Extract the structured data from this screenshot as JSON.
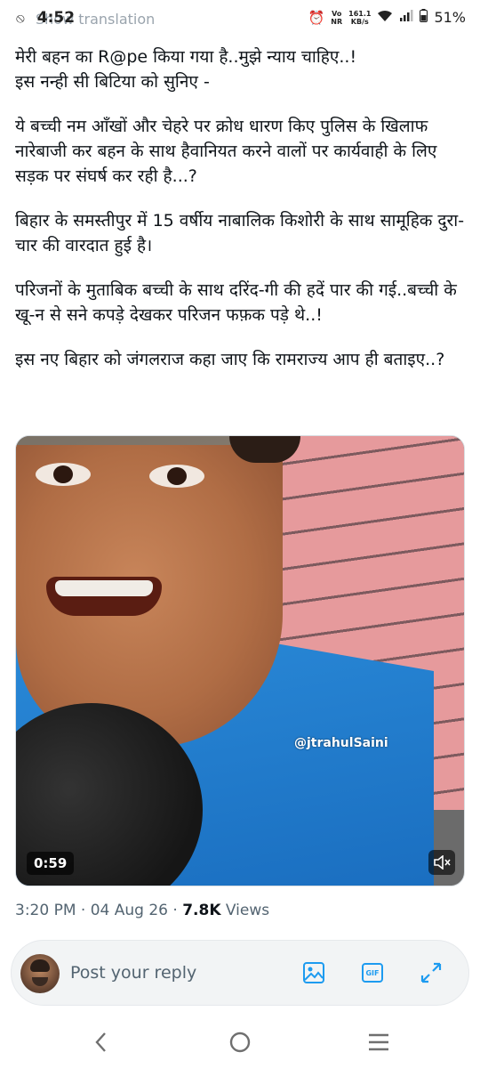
{
  "status_bar": {
    "time": "4:52",
    "ghost_text": "Show translation",
    "network_label": "Vo\nNR",
    "speed_value": "161.1",
    "speed_unit": "KB/s",
    "battery": "51%"
  },
  "tweet": {
    "paragraphs": [
      "मेरी बहन का R@pe किया गया है..मुझे न्याय चाहिए..!\nइस नन्ही सी बिटिया को सुनिए -",
      "ये बच्ची नम आँखों और चेहरे पर क्रोध धारण किए पुलिस के खिलाफ नारेबाजी कर बहन के साथ हैवानियत करने वालों पर कार्यवाही के लिए सड़क पर संघर्ष कर रही है...?",
      "बिहार के समस्तीपुर में 15 वर्षीय नाबालिक किशोरी के साथ सामूहिक दुरा-चार की वारदात हुई है।",
      "परिजनों के मुताबिक बच्ची के साथ दरिंद-गी की हदें पार की गई..बच्ची के खू-न से सने कपड़े देखकर परिजन फफ़क पड़े थे..!",
      "इस नए बिहार को जंगलराज कहा जाए कि रामराज्य आप ही बताइए..?"
    ],
    "media": {
      "watermark": "@jtrahulSaini",
      "duration": "0:59",
      "mute_icon": "volume-mute-icon"
    },
    "meta": {
      "time": "3:20 PM",
      "separator": " · ",
      "date": "04 Aug 26",
      "views_count": "7.8K",
      "views_label": "Views"
    }
  },
  "reply_bar": {
    "placeholder": "Post your reply",
    "icons": [
      "image-icon",
      "gif-icon",
      "expand-icon"
    ],
    "gif_label": "GIF"
  },
  "colors": {
    "accent": "#1d9bf0",
    "text": "#0f1419",
    "secondary": "#536471"
  }
}
